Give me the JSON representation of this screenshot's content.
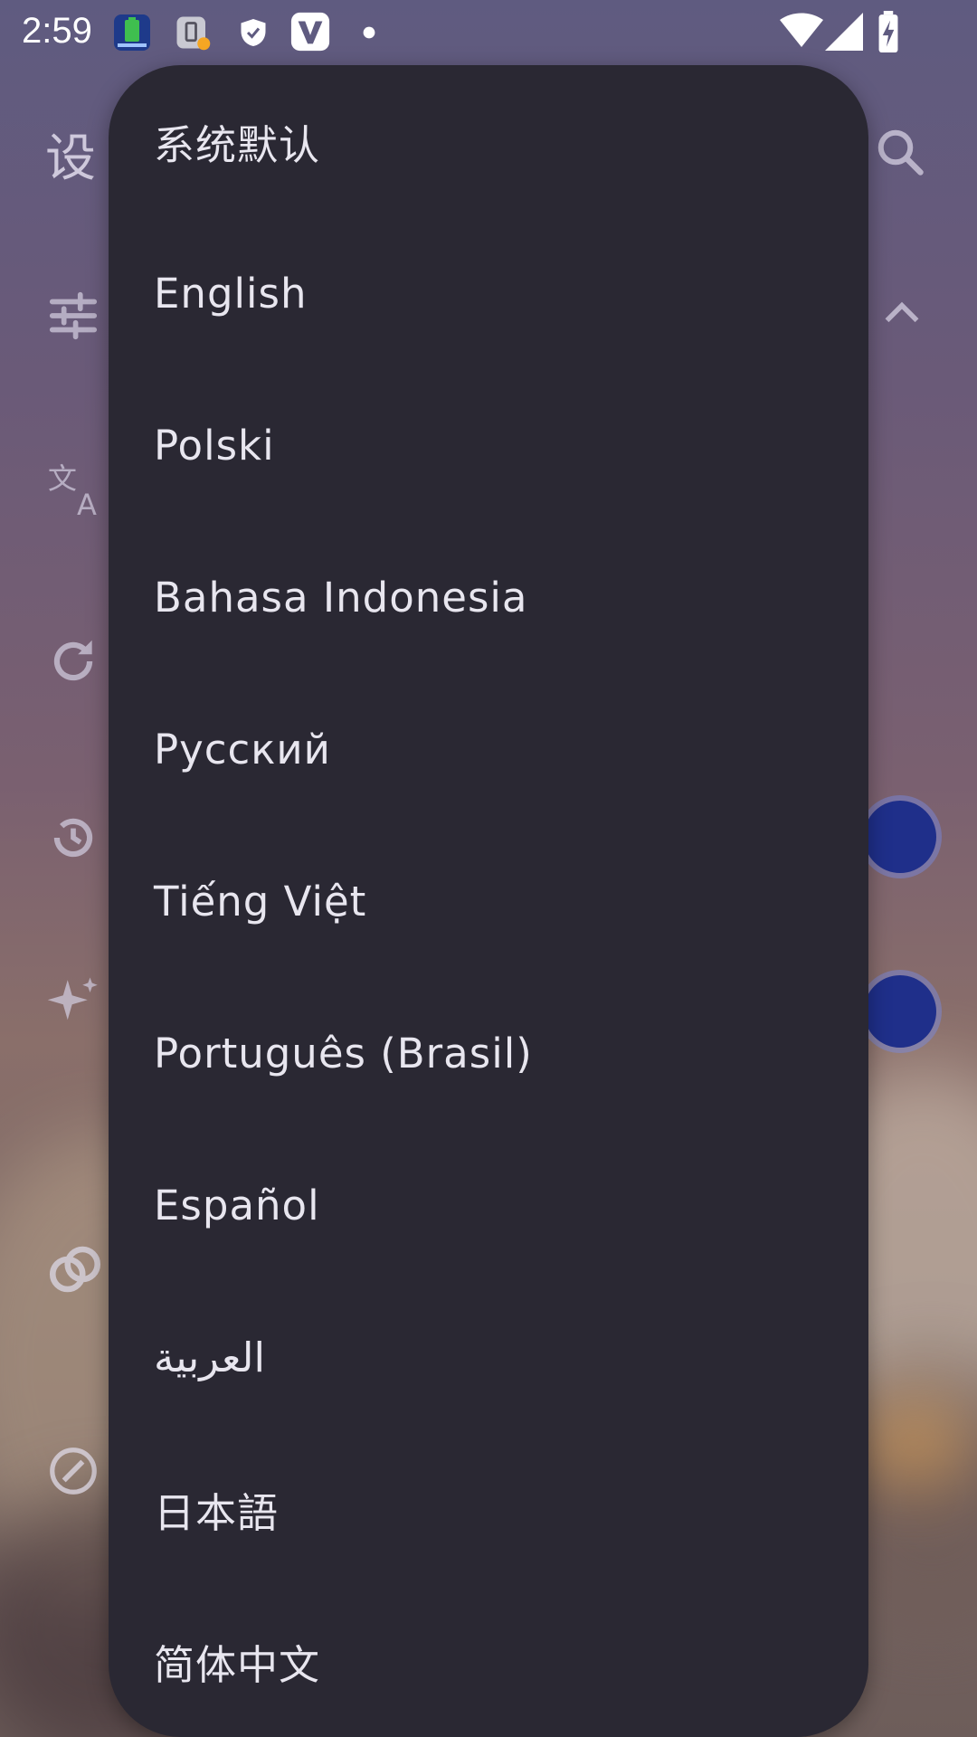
{
  "status_bar": {
    "time": "2:59",
    "icons": [
      "battery-app-icon",
      "battery-alert-icon",
      "shield-icon",
      "vpn-v-icon",
      "dot-icon"
    ],
    "right_icons": [
      "wifi-icon",
      "cellular-signal-icon",
      "battery-charging-icon"
    ]
  },
  "background": {
    "title_partial": "设",
    "icons": [
      "tune-icon",
      "translate-icon",
      "refresh-icon",
      "history-icon",
      "sparkle-icon",
      "link-icon",
      "edit-icon",
      "search-icon",
      "chevron-up-icon"
    ]
  },
  "language_menu": {
    "items": [
      "系统默认",
      "English",
      "Polski",
      "Bahasa Indonesia",
      "Русский",
      "Tiếng Việt",
      "Português (Brasil)",
      "Español",
      "العربية",
      "日本語",
      "简体中文"
    ]
  },
  "colors": {
    "menu_background": "#2a2833",
    "menu_text": "#e8e6ef",
    "toggle_accent": "#1f2f8a"
  }
}
